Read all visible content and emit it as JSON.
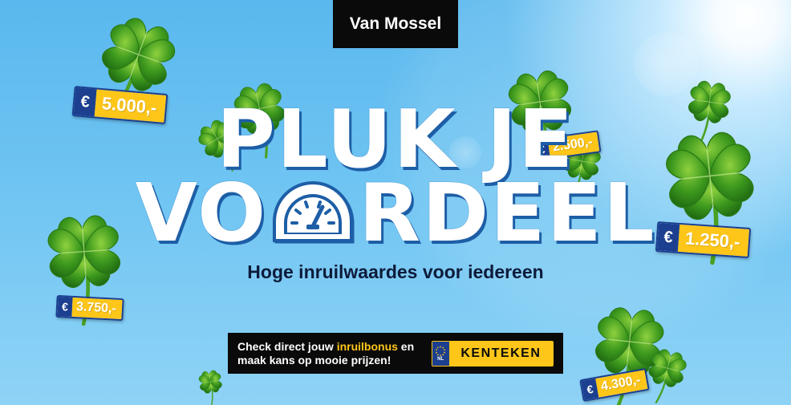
{
  "brand": {
    "name": "Van Mossel"
  },
  "headline": {
    "line1": "PLUK JE",
    "line2_before": "VO",
    "line2_after": "RDEEL"
  },
  "subtitle": "Hoge inruilwaardes voor iedereen",
  "price_tags": {
    "currency": "€",
    "items": [
      "5.000,-",
      "2.500,-",
      "1.250,-",
      "3.750,-",
      "4.300,-"
    ]
  },
  "cta": {
    "text_before": "Check direct jouw ",
    "text_highlight": "inruilbonus",
    "text_after": " en maak kans op mooie prijzen!",
    "plate_country": "NL",
    "plate_placeholder": "KENTEKEN"
  },
  "colors": {
    "tag_yellow": "#ffc61a",
    "tag_blue": "#1c3f8f",
    "headline_shadow": "#1d5ea6",
    "sky": "#6ec4f2"
  },
  "icons": [
    "clover-icon",
    "gauge-icon",
    "eu-stars-icon"
  ]
}
